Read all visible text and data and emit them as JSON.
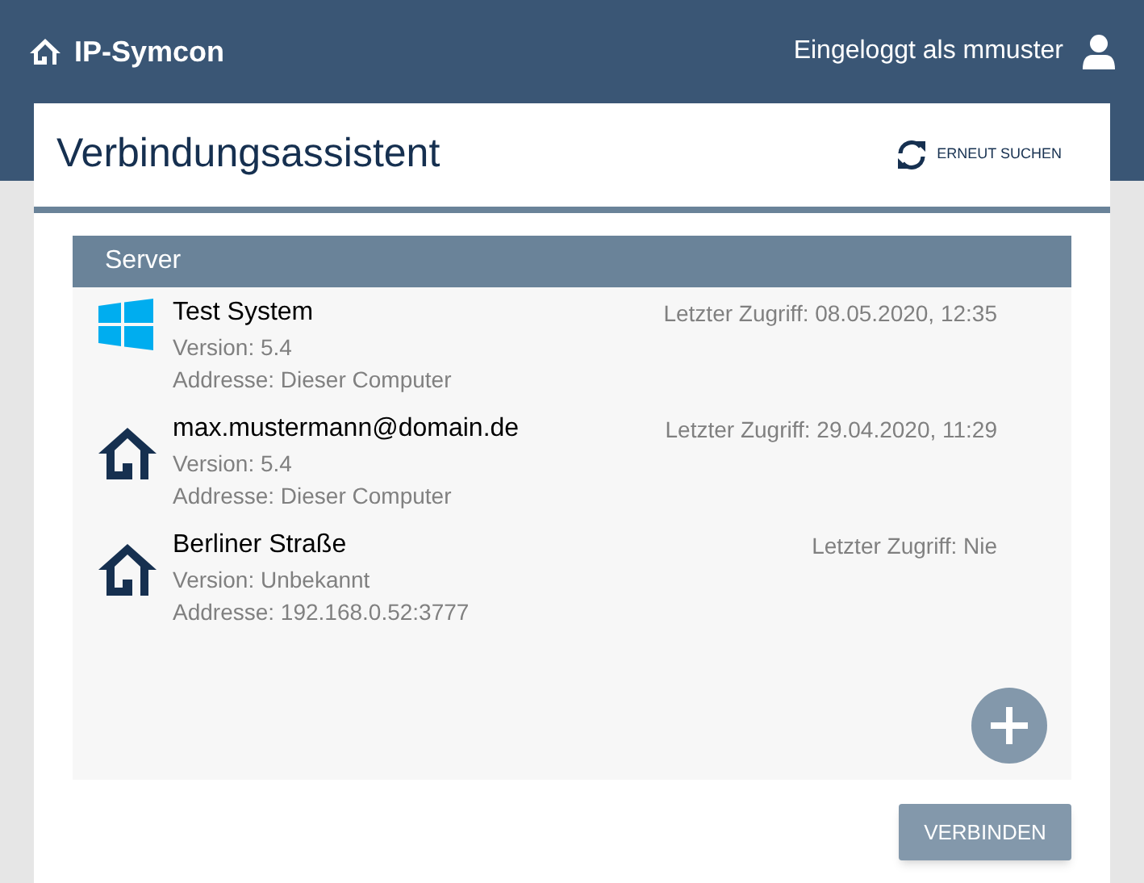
{
  "app": {
    "title": "IP-Symcon",
    "user": "Eingeloggt als mmuster"
  },
  "dialog": {
    "title": "Verbindungsassistent",
    "rescan": "ERNEUT SUCHEN"
  },
  "server_list": {
    "header": "Server",
    "servers": [
      {
        "kind": "windows",
        "name": "Test System",
        "version": "Version: 5.4",
        "address": "Addresse: Dieser Computer",
        "last_access": "Letzter Zugriff: 08.05.2020, 12:35"
      },
      {
        "kind": "home",
        "name": "max.mustermann@domain.de",
        "version": "Version: 5.4",
        "address": "Addresse: Dieser Computer",
        "last_access": "Letzter Zugriff: 29.04.2020, 11:29"
      },
      {
        "kind": "home",
        "name": "Berliner Straße",
        "version": "Version: Unbekannt",
        "address": "Addresse: 192.168.0.52:3777",
        "last_access": "Letzter Zugriff: Nie"
      }
    ]
  },
  "connect_button": "VERBINDEN"
}
